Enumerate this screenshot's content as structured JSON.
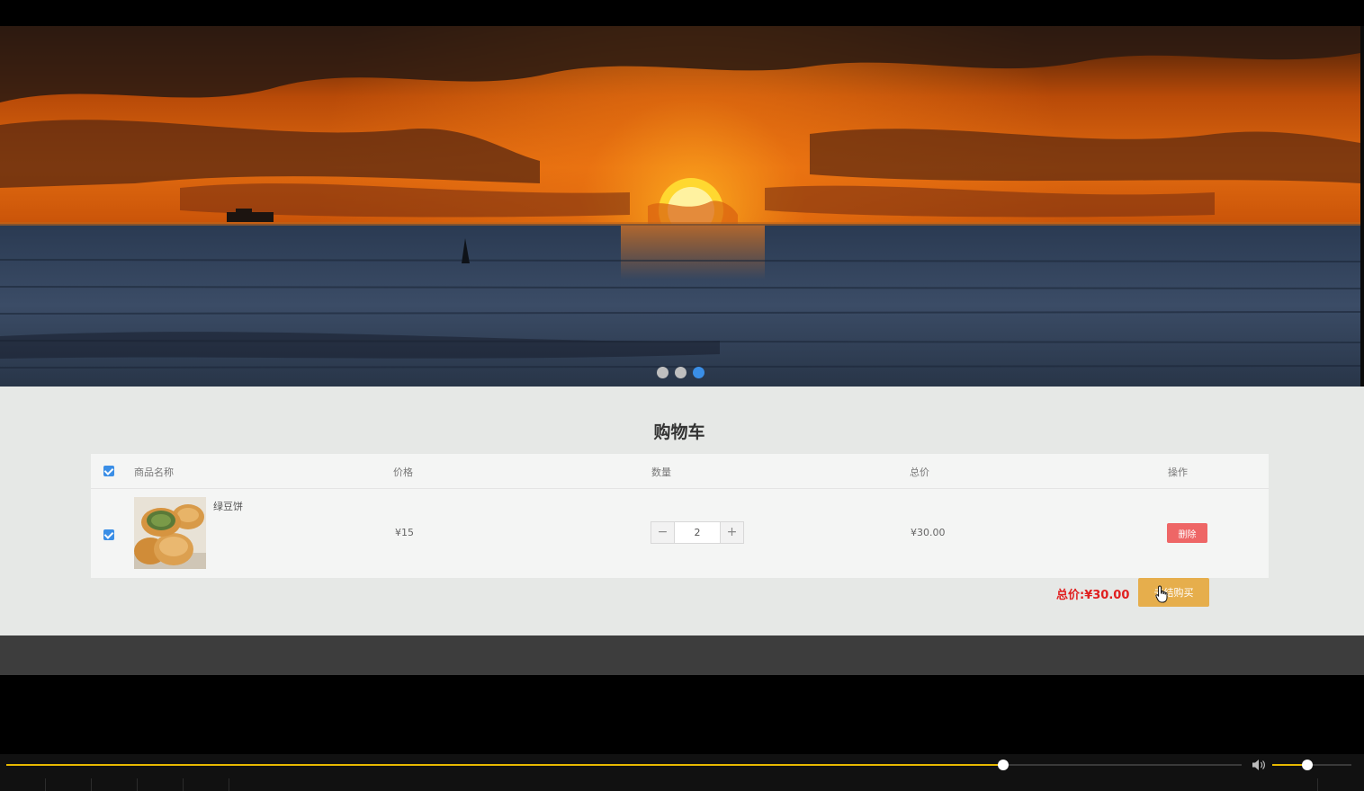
{
  "banner": {
    "slides": 3,
    "active_slide": 3
  },
  "cart": {
    "title": "购物车",
    "headers": {
      "name": "商品名称",
      "price": "价格",
      "qty": "数量",
      "total": "总价",
      "action": "操作"
    },
    "items": [
      {
        "name": "绿豆饼",
        "price": "¥15",
        "qty": "2",
        "subtotal": "¥30.00",
        "delete_label": "删除",
        "checked": true
      }
    ],
    "select_all_checked": true,
    "summary_label": "总价:¥30.00",
    "buy_label": "去结购买"
  },
  "player": {
    "progress": 0.807,
    "volume": 0.44
  },
  "colors": {
    "accent_blue": "#3a8ee6",
    "delete_red": "#ee6666",
    "buy_gold": "#e6ae4c",
    "total_red": "#e02020",
    "player_yellow": "#e6b800"
  }
}
